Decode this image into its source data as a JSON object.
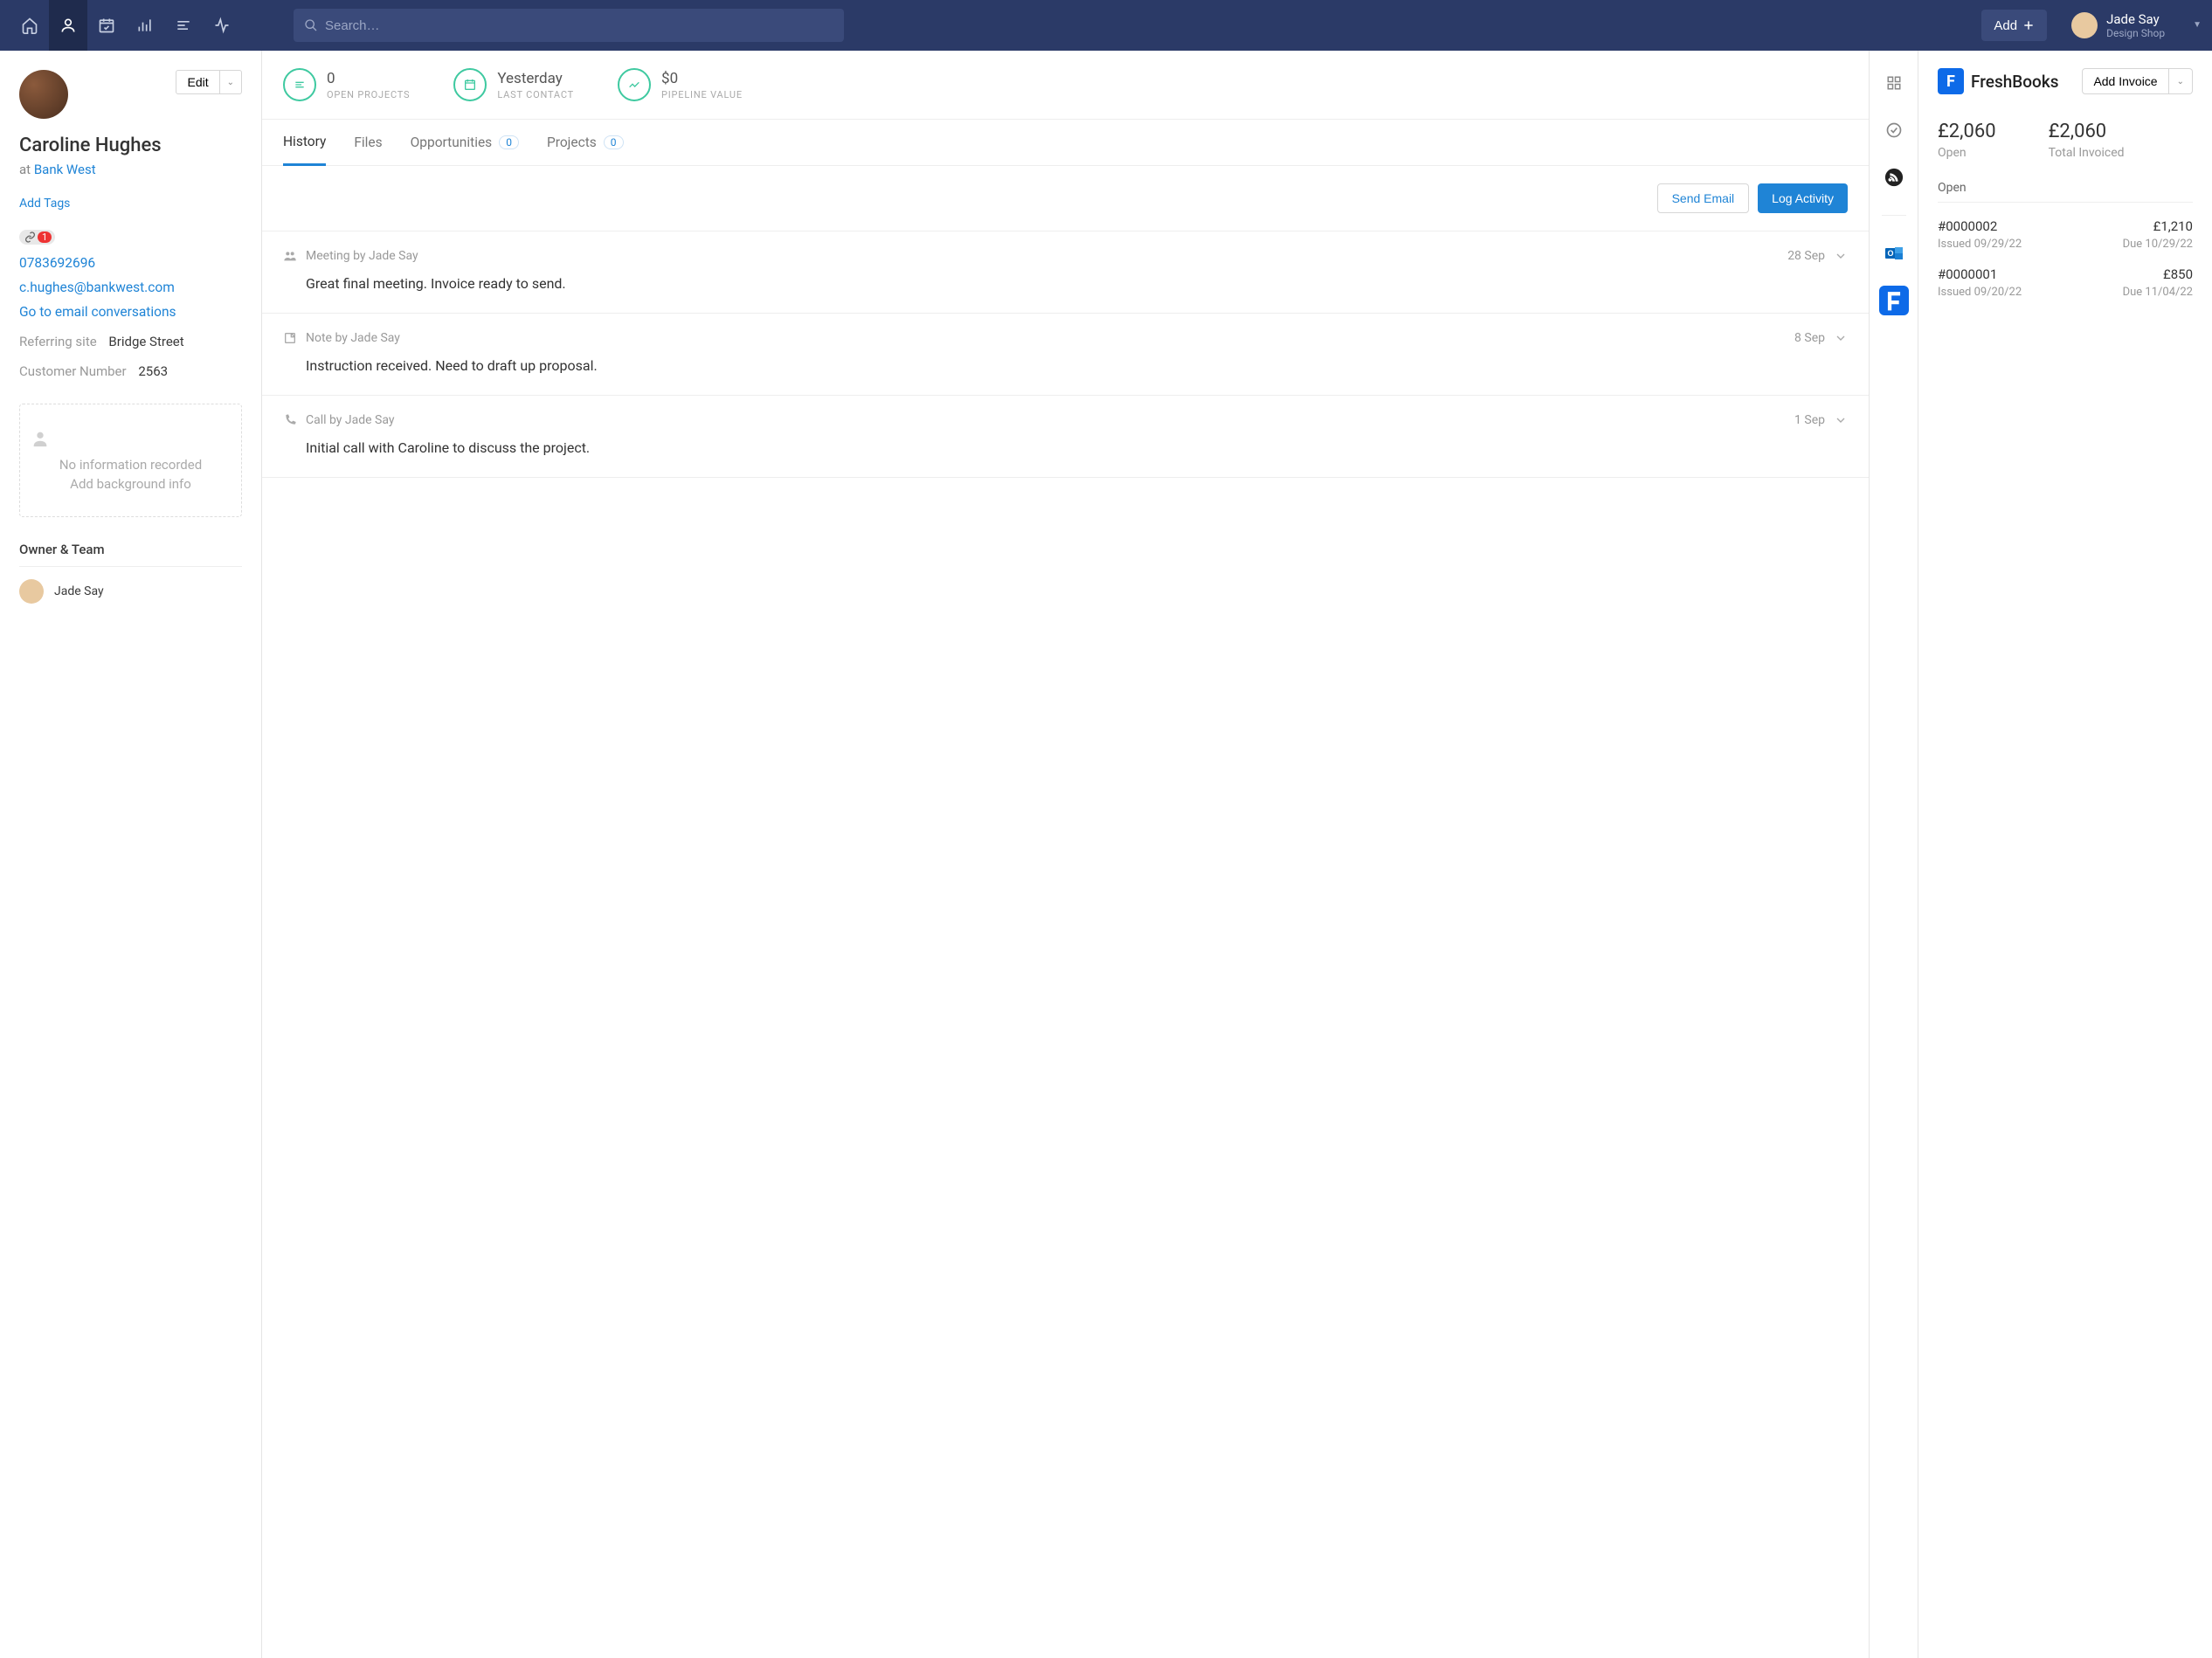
{
  "topbar": {
    "search_placeholder": "Search…",
    "add_label": "Add",
    "user": {
      "name": "Jade Say",
      "org": "Design Shop"
    }
  },
  "contact": {
    "name": "Caroline Hughes",
    "at_prefix": "at",
    "company": "Bank West",
    "edit_label": "Edit",
    "add_tags_label": "Add Tags",
    "link_count": "1",
    "phone": "0783692696",
    "email": "c.hughes@bankwest.com",
    "convo_link": "Go to email conversations",
    "referring_label": "Referring site",
    "referring_value": "Bridge Street",
    "customer_no_label": "Customer Number",
    "customer_no_value": "2563",
    "bg_line1": "No information recorded",
    "bg_line2": "Add background info",
    "owner_team_title": "Owner & Team",
    "owner_name": "Jade Say"
  },
  "stats": {
    "projects_value": "0",
    "projects_label": "OPEN PROJECTS",
    "contact_value": "Yesterday",
    "contact_label": "LAST CONTACT",
    "pipeline_value": "$0",
    "pipeline_label": "PIPELINE VALUE"
  },
  "tabs": {
    "history": "History",
    "files": "Files",
    "opportunities": "Opportunities",
    "opp_count": "0",
    "projects": "Projects",
    "proj_count": "0"
  },
  "actions": {
    "send_email": "Send Email",
    "log_activity": "Log Activity"
  },
  "activity": [
    {
      "meta": "Meeting by Jade Say",
      "date": "28 Sep",
      "body": "Great final meeting. Invoice ready to send."
    },
    {
      "meta": "Note by Jade Say",
      "date": "8 Sep",
      "body": "Instruction received. Need to draft up proposal."
    },
    {
      "meta": "Call by Jade Say",
      "date": "1 Sep",
      "body": "Initial call with Caroline to discuss the project."
    }
  ],
  "freshbooks": {
    "brand": "FreshBooks",
    "add_invoice": "Add Invoice",
    "open_value": "£2,060",
    "open_label": "Open",
    "total_value": "£2,060",
    "total_label": "Total Invoiced",
    "section_open": "Open",
    "invoices": [
      {
        "num": "#0000002",
        "amount": "£1,210",
        "issued": "Issued 09/29/22",
        "due": "Due 10/29/22"
      },
      {
        "num": "#0000001",
        "amount": "£850",
        "issued": "Issued 09/20/22",
        "due": "Due 11/04/22"
      }
    ]
  }
}
